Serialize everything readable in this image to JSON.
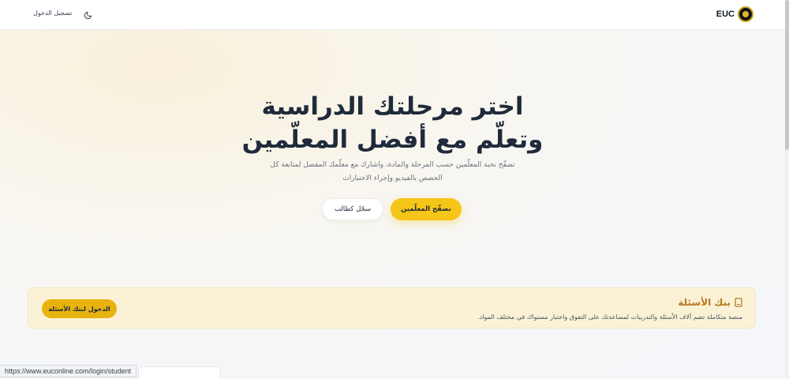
{
  "header": {
    "brand": "EUC",
    "login_label": "تسجيل الدخول",
    "theme_icon": "moon-icon",
    "logo_icon": "euc-logo-icon"
  },
  "hero": {
    "title": "اختر مرحلتك الدراسية وتعلّم مع أفضل المعلّمين",
    "subtitle": "تصفّح نخبة المعلّمين حسب المرحلة والمادة، واشارك مع معلّمك المفضل لمتابعة كل الحصص بالفيديو وإجراء الاختبارات",
    "primary_button": "تصفّح المعلّمين",
    "secondary_button": "سجّل كطالب"
  },
  "question_bank": {
    "title": "بنك الأسئلة",
    "icon": "book-icon",
    "description": "منصة متكاملة تضم آلاف الأسئلة والتدريبات لمساعدتك على التفوق واختبار مستواك في مختلف المواد.",
    "button": "الدخول لبنك الأسئلة"
  },
  "status_bar": {
    "url": "https://www.euconline.com/login/student"
  },
  "colors": {
    "accent": "#f5c518",
    "accent_dark": "#e8b30f",
    "card_bg": "#fbf2d6",
    "title_text": "#1f2a3a"
  }
}
